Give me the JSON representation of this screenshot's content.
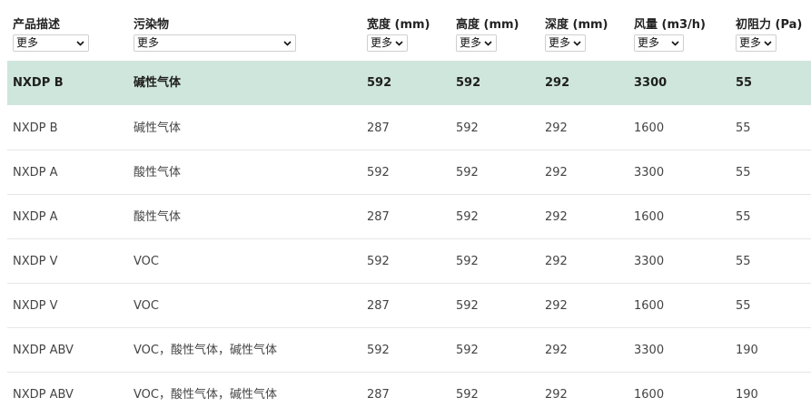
{
  "columns": [
    {
      "label": "产品描述",
      "filter": "更多"
    },
    {
      "label": "污染物",
      "filter": "更多"
    },
    {
      "label": "宽度 (mm)",
      "filter": "更多"
    },
    {
      "label": "高度 (mm)",
      "filter": "更多"
    },
    {
      "label": "深度 (mm)",
      "filter": "更多"
    },
    {
      "label": "风量 (m3/h)",
      "filter": "更多"
    },
    {
      "label": "初阻力 (Pa)",
      "filter": "更多"
    }
  ],
  "rows": [
    {
      "highlighted": true,
      "cells": [
        "NXDP B",
        "碱性气体",
        "592",
        "592",
        "292",
        "3300",
        "55"
      ]
    },
    {
      "cells": [
        "NXDP B",
        "碱性气体",
        "287",
        "592",
        "292",
        "1600",
        "55"
      ]
    },
    {
      "cells": [
        "NXDP A",
        "酸性气体",
        "592",
        "592",
        "292",
        "3300",
        "55"
      ]
    },
    {
      "cells": [
        "NXDP A",
        "酸性气体",
        "287",
        "592",
        "292",
        "1600",
        "55"
      ]
    },
    {
      "cells": [
        "NXDP V",
        "VOC",
        "592",
        "592",
        "292",
        "3300",
        "55"
      ]
    },
    {
      "cells": [
        "NXDP V",
        "VOC",
        "287",
        "592",
        "292",
        "1600",
        "55"
      ]
    },
    {
      "cells": [
        "NXDP ABV",
        "VOC，酸性气体，碱性气体",
        "592",
        "592",
        "292",
        "3300",
        "190"
      ]
    },
    {
      "cells": [
        "NXDP ABV",
        "VOC，酸性气体，碱性气体",
        "287",
        "592",
        "292",
        "1600",
        "190"
      ]
    }
  ],
  "colors": {
    "highlight_row": "#cfe6dc",
    "row_divider": "#e6e6e6"
  },
  "icons": {
    "filter_chevron": "chevron-down-icon"
  }
}
